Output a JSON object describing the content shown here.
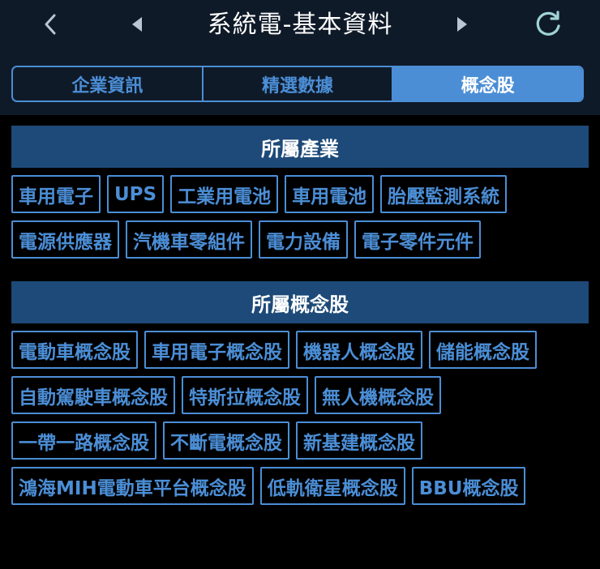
{
  "header": {
    "title": "系統電-基本資料",
    "back_icon": "chevron-left-icon",
    "prev_icon": "triangle-left-icon",
    "next_icon": "triangle-right-icon",
    "refresh_icon": "refresh-icon"
  },
  "tabs": [
    {
      "label": "企業資訊",
      "active": false
    },
    {
      "label": "精選數據",
      "active": false
    },
    {
      "label": "概念股",
      "active": true
    }
  ],
  "sections": {
    "industry": {
      "title": "所屬產業",
      "tags": [
        "車用電子",
        "UPS",
        "工業用電池",
        "車用電池",
        "胎壓監測系統",
        "電源供應器",
        "汽機車零組件",
        "電力設備",
        "電子零件元件"
      ]
    },
    "concept": {
      "title": "所屬概念股",
      "tags": [
        "電動車概念股",
        "車用電子概念股",
        "機器人概念股",
        "儲能概念股",
        "自動駕駛車概念股",
        "特斯拉概念股",
        "無人機概念股",
        "一帶一路概念股",
        "不斷電概念股",
        "新基建概念股",
        "鴻海MIH電動車平台概念股",
        "低軌衛星概念股",
        "BBU概念股"
      ]
    }
  },
  "colors": {
    "accent": "#4b8ed6",
    "header_bg": "#0f1a28",
    "section_bg": "#1d4a78",
    "refresh_icon": "#9fd3d6",
    "nav_icon": "#b8c6d6"
  }
}
